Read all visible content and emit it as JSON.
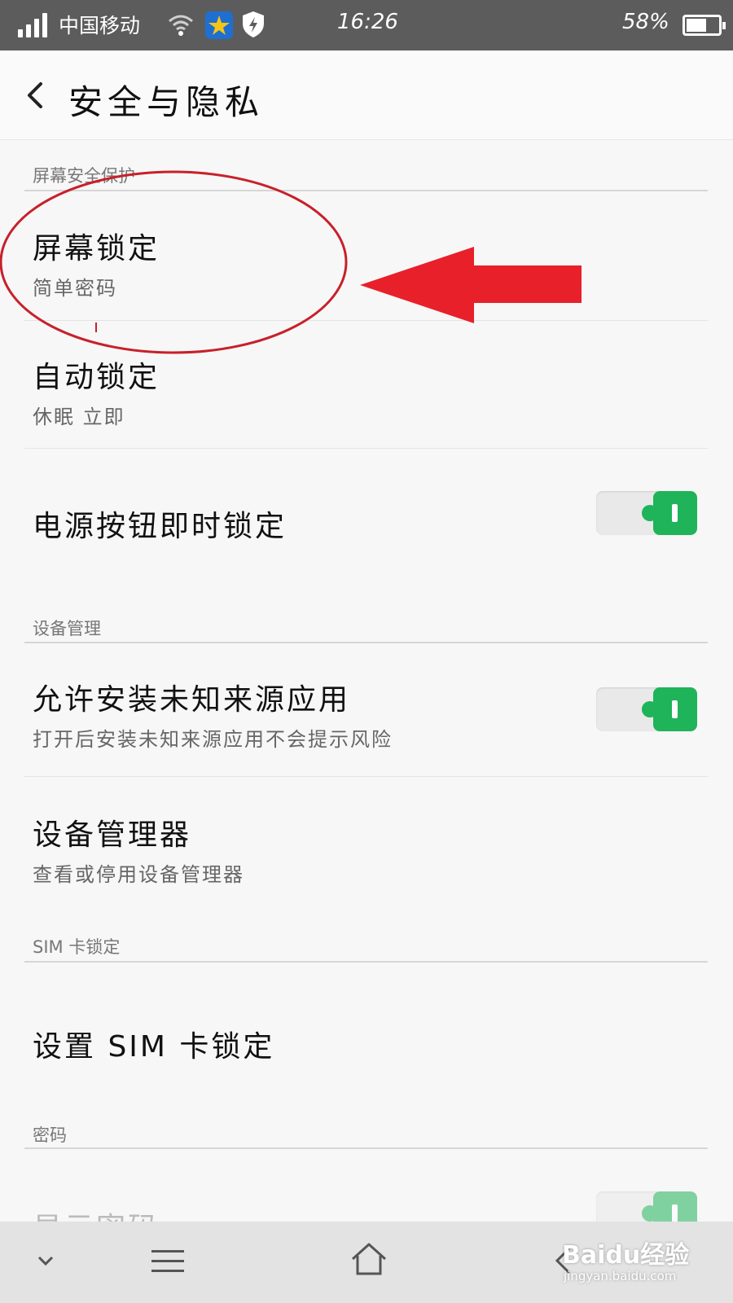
{
  "status_bar": {
    "carrier": "中国移动",
    "time": "16:26",
    "battery_percent": "58%",
    "icons": [
      "signal-icon",
      "wifi-icon",
      "app-notification-icon",
      "shield-icon",
      "battery-icon"
    ]
  },
  "header": {
    "title": "安全与隐私",
    "back_icon": "back-arrow-icon"
  },
  "sections": [
    {
      "header": "屏幕安全保护",
      "items": [
        {
          "title": "屏幕锁定",
          "subtitle": "简单密码"
        },
        {
          "title": "自动锁定",
          "subtitle": "休眠 立即"
        },
        {
          "title": "电源按钮即时锁定",
          "toggle": true
        }
      ]
    },
    {
      "header": "设备管理",
      "items": [
        {
          "title": "允许安装未知来源应用",
          "subtitle": "打开后安装未知来源应用不会提示风险",
          "toggle": true
        },
        {
          "title": "设备管理器",
          "subtitle": "查看或停用设备管理器"
        }
      ]
    },
    {
      "header": "SIM 卡锁定",
      "items": [
        {
          "title": "设置 SIM 卡锁定"
        }
      ]
    },
    {
      "header": "密码",
      "items": [
        {
          "title": "显示密码",
          "toggle": true
        }
      ]
    }
  ],
  "annotation": {
    "colors": {
      "circle": "#c8202a",
      "arrow": "#e8202a"
    }
  },
  "bottom_nav": {
    "icons": [
      "chevron-down-icon",
      "menu-icon",
      "home-icon",
      "back-icon"
    ]
  },
  "watermark": {
    "brand": "Baidu经验",
    "url": "jingyan.baidu.com"
  },
  "colors": {
    "status_bar_bg": "#5c5c5c",
    "toggle_on": "#1fb35a",
    "background": "#f7f7f7"
  }
}
